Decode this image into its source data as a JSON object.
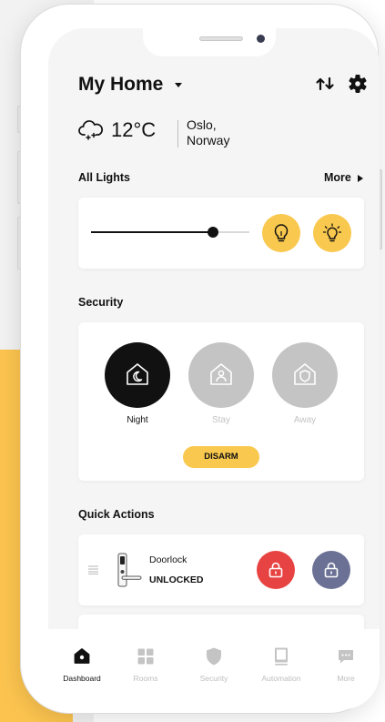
{
  "header": {
    "title": "My Home",
    "title_caret_icon": "caret-down-icon",
    "swap_icon": "swap-icon",
    "settings_icon": "gear-icon"
  },
  "weather": {
    "icon": "snow-cloud-icon",
    "temperature": "12°C",
    "city_line1": "Oslo,",
    "city_line2": "Norway"
  },
  "lights": {
    "title": "All Lights",
    "more_label": "More",
    "brightness": 0.77,
    "buttons": [
      {
        "icon": "bulb-off-icon"
      },
      {
        "icon": "bulb-on-icon"
      }
    ]
  },
  "security": {
    "title": "Security",
    "modes": [
      {
        "label": "Night",
        "icon": "home-moon-icon",
        "active": true
      },
      {
        "label": "Stay",
        "icon": "home-person-icon",
        "active": false
      },
      {
        "label": "Away",
        "icon": "home-shield-icon",
        "active": false
      }
    ],
    "disarm_label": "DISARM"
  },
  "quick_actions": {
    "title": "Quick Actions",
    "items": [
      {
        "name": "Doorlock",
        "status": "UNLOCKED",
        "icon": "doorlock-image"
      }
    ]
  },
  "tabs": [
    {
      "label": "Dashboard",
      "icon": "home-icon",
      "active": true
    },
    {
      "label": "Rooms",
      "icon": "grid-icon",
      "active": false
    },
    {
      "label": "Security",
      "icon": "shield-icon",
      "active": false
    },
    {
      "label": "Automation",
      "icon": "tablet-icon",
      "active": false
    },
    {
      "label": "More",
      "icon": "chat-icon",
      "active": false
    }
  ],
  "colors": {
    "accent_yellow": "#f9c84e",
    "active_black": "#111111",
    "inactive_gray": "#c4c4c4",
    "lock_red": "#e84343",
    "unlock_slate": "#6a7194"
  }
}
